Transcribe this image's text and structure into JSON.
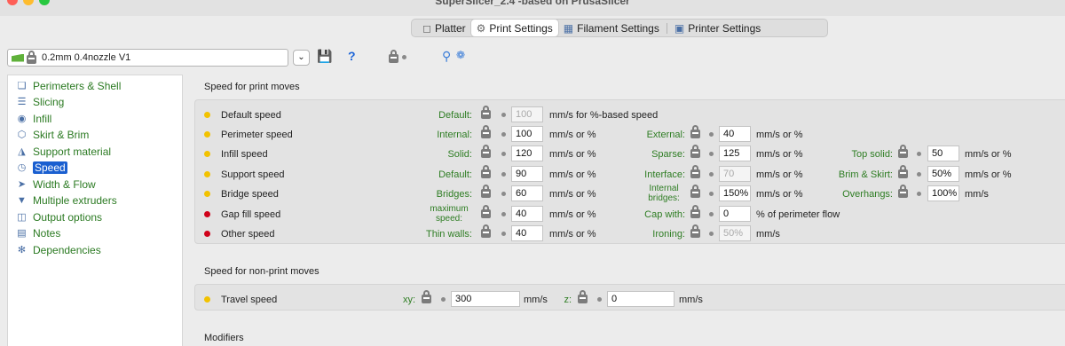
{
  "window": {
    "title": "SuperSlicer_2.4 -based on PrusaSlicer"
  },
  "tabs": [
    {
      "label": "Platter",
      "icon": "cube-icon"
    },
    {
      "label": "Print Settings",
      "icon": "gear-icon",
      "active": true
    },
    {
      "label": "Filament Settings",
      "icon": "spool-icon"
    },
    {
      "label": "Printer Settings",
      "icon": "printer-icon"
    }
  ],
  "preset": {
    "name": "0.2mm 0.4nozzle V1",
    "question": "?"
  },
  "sidebar": {
    "items": [
      {
        "label": "Perimeters & Shell",
        "icon": "cube-icon"
      },
      {
        "label": "Slicing",
        "icon": "layers-icon"
      },
      {
        "label": "Infill",
        "icon": "infill-icon"
      },
      {
        "label": "Skirt & Brim",
        "icon": "hexagon-icon"
      },
      {
        "label": "Support material",
        "icon": "support-icon"
      },
      {
        "label": "Speed",
        "icon": "speedometer-icon",
        "selected": true
      },
      {
        "label": "Width & Flow",
        "icon": "width-icon"
      },
      {
        "label": "Multiple extruders",
        "icon": "funnel-icon"
      },
      {
        "label": "Output options",
        "icon": "output-icon"
      },
      {
        "label": "Notes",
        "icon": "notes-icon"
      },
      {
        "label": "Dependencies",
        "icon": "wrench-icon"
      }
    ]
  },
  "speed_print": {
    "title": "Speed for print moves",
    "rows": [
      {
        "label": "Default speed",
        "dot_color": "#f2c200",
        "c1": {
          "label": "Default:",
          "value": "100",
          "unit": "mm/s for %-based speed",
          "disabled": true
        }
      },
      {
        "label": "Perimeter speed",
        "dot_color": "#f2c200",
        "c1": {
          "label": "Internal:",
          "value": "100",
          "unit": "mm/s or %"
        },
        "c2": {
          "label": "External:",
          "value": "40",
          "unit": "mm/s or %"
        }
      },
      {
        "label": "Infill speed",
        "dot_color": "#f2c200",
        "c1": {
          "label": "Solid:",
          "value": "120",
          "unit": "mm/s or %"
        },
        "c2": {
          "label": "Sparse:",
          "value": "125",
          "unit": "mm/s or %"
        },
        "c3": {
          "label": "Top solid:",
          "value": "50",
          "unit": "mm/s or %"
        }
      },
      {
        "label": "Support speed",
        "dot_color": "#f2c200",
        "c1": {
          "label": "Default:",
          "value": "90",
          "unit": "mm/s or %"
        },
        "c2": {
          "label": "Interface:",
          "value": "70",
          "unit": "mm/s or %",
          "disabled": true
        },
        "c3": {
          "label": "Brim & Skirt:",
          "value": "50%",
          "unit": "mm/s or %"
        }
      },
      {
        "label": "Bridge speed",
        "dot_color": "#f2c200",
        "c1": {
          "label": "Bridges:",
          "value": "60",
          "unit": "mm/s or %"
        },
        "c2": {
          "label_line1": "Internal",
          "label_line2": "bridges:",
          "value": "150%",
          "unit": "mm/s or %"
        },
        "c3": {
          "label": "Overhangs:",
          "value": "100%",
          "unit": "mm/s"
        }
      },
      {
        "label": "Gap fill speed",
        "dot_color": "#d0021b",
        "c1": {
          "label_line1": "maximum",
          "label_line2": "speed:",
          "value": "40",
          "unit": "mm/s or %"
        },
        "c2": {
          "label": "Cap with:",
          "value": "0",
          "unit": "% of perimeter flow"
        }
      },
      {
        "label": "Other speed",
        "dot_color": "#d0021b",
        "c1": {
          "label": "Thin walls:",
          "value": "40",
          "unit": "mm/s or %"
        },
        "c2": {
          "label": "Ironing:",
          "value": "50%",
          "unit": "mm/s",
          "disabled": true
        }
      }
    ]
  },
  "speed_nonprint": {
    "title": "Speed for non-print moves",
    "travel": {
      "label": "Travel speed",
      "dot_color": "#f2c200",
      "xy": {
        "label": "xy:",
        "value": "300",
        "unit": "mm/s"
      },
      "z": {
        "label": "z:",
        "value": "0",
        "unit": "mm/s"
      }
    }
  },
  "modifiers": {
    "title": "Modifiers"
  }
}
